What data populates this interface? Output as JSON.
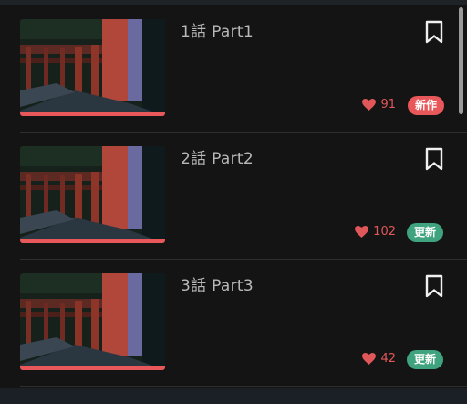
{
  "episodes": [
    {
      "title": "1話 Part1",
      "likes": "91",
      "badge": "新作",
      "badge_color": "#e8585a",
      "progress": 1.0
    },
    {
      "title": "2話 Part2",
      "likes": "102",
      "badge": "更新",
      "badge_color": "#3fa37f",
      "progress": 1.0
    },
    {
      "title": "3話 Part3",
      "likes": "42",
      "badge": "更新",
      "badge_color": "#3fa37f",
      "progress": 1.0
    }
  ],
  "icons": {
    "bookmark": "bookmark-icon",
    "heart": "heart-icon"
  },
  "colors": {
    "like": "#e0575a",
    "progress": "#e8585a",
    "background": "#141414"
  }
}
